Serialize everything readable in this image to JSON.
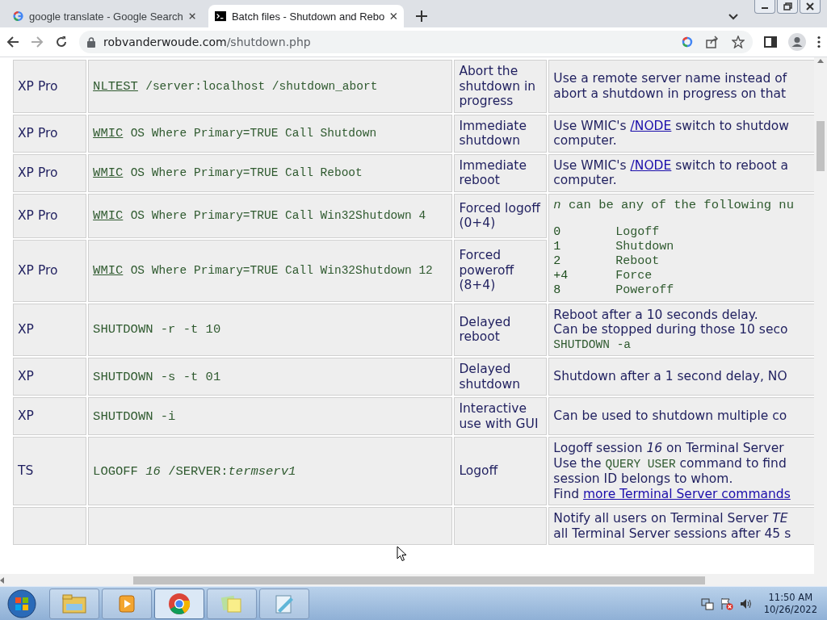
{
  "browser": {
    "tabs": [
      {
        "title": "google translate - Google Search",
        "selected": false
      },
      {
        "title": "Batch files - Shutdown and Rebo",
        "selected": true
      }
    ],
    "address": {
      "host": "robvanderwoude.com",
      "path": "/shutdown.php"
    }
  },
  "table": {
    "rows": [
      {
        "os": "XP Pro",
        "command": [
          {
            "kind": "link",
            "text": "NLTEST"
          },
          {
            "kind": "code",
            "text": "/server:localhost /shutdown_abort"
          }
        ],
        "description": "Abort the shutdown in progress",
        "notes": {
          "kind": "lines",
          "lines": [
            [
              {
                "kind": "text",
                "text": "Use a remote server name instead of"
              }
            ],
            [
              {
                "kind": "text",
                "text": "abort a shutdown in progress on that"
              }
            ]
          ]
        }
      },
      {
        "os": "XP Pro",
        "command": [
          {
            "kind": "link",
            "text": "WMIC"
          },
          {
            "kind": "code",
            "text": "OS Where Primary=TRUE Call Shutdown"
          }
        ],
        "description": "Immediate shutdown",
        "notes": {
          "kind": "lines",
          "lines": [
            [
              {
                "kind": "text",
                "text": "Use WMIC's"
              },
              {
                "kind": "link",
                "text": "/NODE"
              },
              {
                "kind": "text",
                "text": "switch to shutdow"
              }
            ],
            [
              {
                "kind": "text",
                "text": "computer."
              }
            ]
          ]
        }
      },
      {
        "os": "XP Pro",
        "command": [
          {
            "kind": "link",
            "text": "WMIC"
          },
          {
            "kind": "code",
            "text": "OS Where Primary=TRUE Call Reboot"
          }
        ],
        "description": "Immediate reboot",
        "notes": {
          "kind": "lines",
          "lines": [
            [
              {
                "kind": "text",
                "text": "Use WMIC's"
              },
              {
                "kind": "link",
                "text": "/NODE"
              },
              {
                "kind": "text",
                "text": "switch to reboot a"
              }
            ],
            [
              {
                "kind": "text",
                "text": "computer."
              }
            ]
          ]
        }
      },
      {
        "os": "XP Pro",
        "command": [
          {
            "kind": "link",
            "text": "WMIC"
          },
          {
            "kind": "code",
            "text": "OS Where Primary=TRUE Call Win32Shutdown 4"
          }
        ],
        "description": "Forced logoff (0+4)",
        "notes": {
          "kind": "codes",
          "intro": "*n* can be any of the following nu",
          "codes": [
            {
              "code": "0",
              "meaning": "Logoff"
            },
            {
              "code": "1",
              "meaning": "Shutdown"
            },
            {
              "code": "2",
              "meaning": "Reboot"
            },
            {
              "code": "+4",
              "meaning": "Force"
            },
            {
              "code": "8",
              "meaning": "Poweroff"
            }
          ]
        }
      },
      {
        "os": "XP Pro",
        "command": [
          {
            "kind": "link",
            "text": "WMIC"
          },
          {
            "kind": "code",
            "text": "OS Where Primary=TRUE Call Win32Shutdown 12"
          }
        ],
        "description": "Forced poweroff (8+4)"
      },
      {
        "os": "XP",
        "command": [
          {
            "kind": "code",
            "text": "SHUTDOWN -r -t 10"
          }
        ],
        "description": "Delayed reboot",
        "notes": {
          "kind": "lines",
          "lines": [
            [
              {
                "kind": "text",
                "text": "Reboot after a 10 seconds delay."
              }
            ],
            [
              {
                "kind": "text",
                "text": "Can be stopped during those 10 seco"
              }
            ],
            [
              {
                "kind": "code",
                "text": "SHUTDOWN -a"
              }
            ]
          ]
        }
      },
      {
        "os": "XP",
        "command": [
          {
            "kind": "code",
            "text": "SHUTDOWN -s -t 01"
          }
        ],
        "description": "Delayed shutdown",
        "notes": {
          "kind": "lines",
          "lines": [
            [
              {
                "kind": "text",
                "text": "Shutdown after a 1 second delay, NO"
              }
            ]
          ]
        }
      },
      {
        "os": "XP",
        "command": [
          {
            "kind": "code",
            "text": "SHUTDOWN -i"
          }
        ],
        "description": "Interactive use with GUI",
        "notes": {
          "kind": "lines",
          "lines": [
            [
              {
                "kind": "text",
                "text": "Can be used to shutdown multiple co"
              }
            ]
          ]
        }
      },
      {
        "os": "TS",
        "command": [
          {
            "kind": "code",
            "text": "LOGOFF *16* /SERVER:*termserv1*"
          }
        ],
        "description": "Logoff",
        "notes": {
          "kind": "lines",
          "lines": [
            [
              {
                "kind": "text",
                "text": "Logoff session *16* on Terminal Server"
              }
            ],
            [
              {
                "kind": "text",
                "text": "Use the"
              },
              {
                "kind": "code",
                "text": "QUERY USER"
              },
              {
                "kind": "text",
                "text": "command to find"
              }
            ],
            [
              {
                "kind": "text",
                "text": "session ID belongs to whom."
              }
            ],
            [
              {
                "kind": "text",
                "text": "Find"
              },
              {
                "kind": "link",
                "text": "more Terminal Server commands"
              }
            ]
          ]
        }
      },
      {
        "notes": {
          "kind": "lines",
          "lines": [
            [
              {
                "kind": "text",
                "text": "Notify all users on Terminal Server *TE*"
              }
            ],
            [
              {
                "kind": "text",
                "text": "all Terminal Server sessions after 45 s"
              }
            ]
          ]
        }
      }
    ]
  },
  "taskbar": {
    "apps": [
      {
        "kind": "explorer",
        "selected": false
      },
      {
        "kind": "media",
        "selected": false
      },
      {
        "kind": "chrome",
        "selected": true
      },
      {
        "kind": "notes",
        "selected": false
      },
      {
        "kind": "notepad",
        "selected": false
      }
    ],
    "time": "11:50 AM",
    "date": "10/26/2022"
  }
}
